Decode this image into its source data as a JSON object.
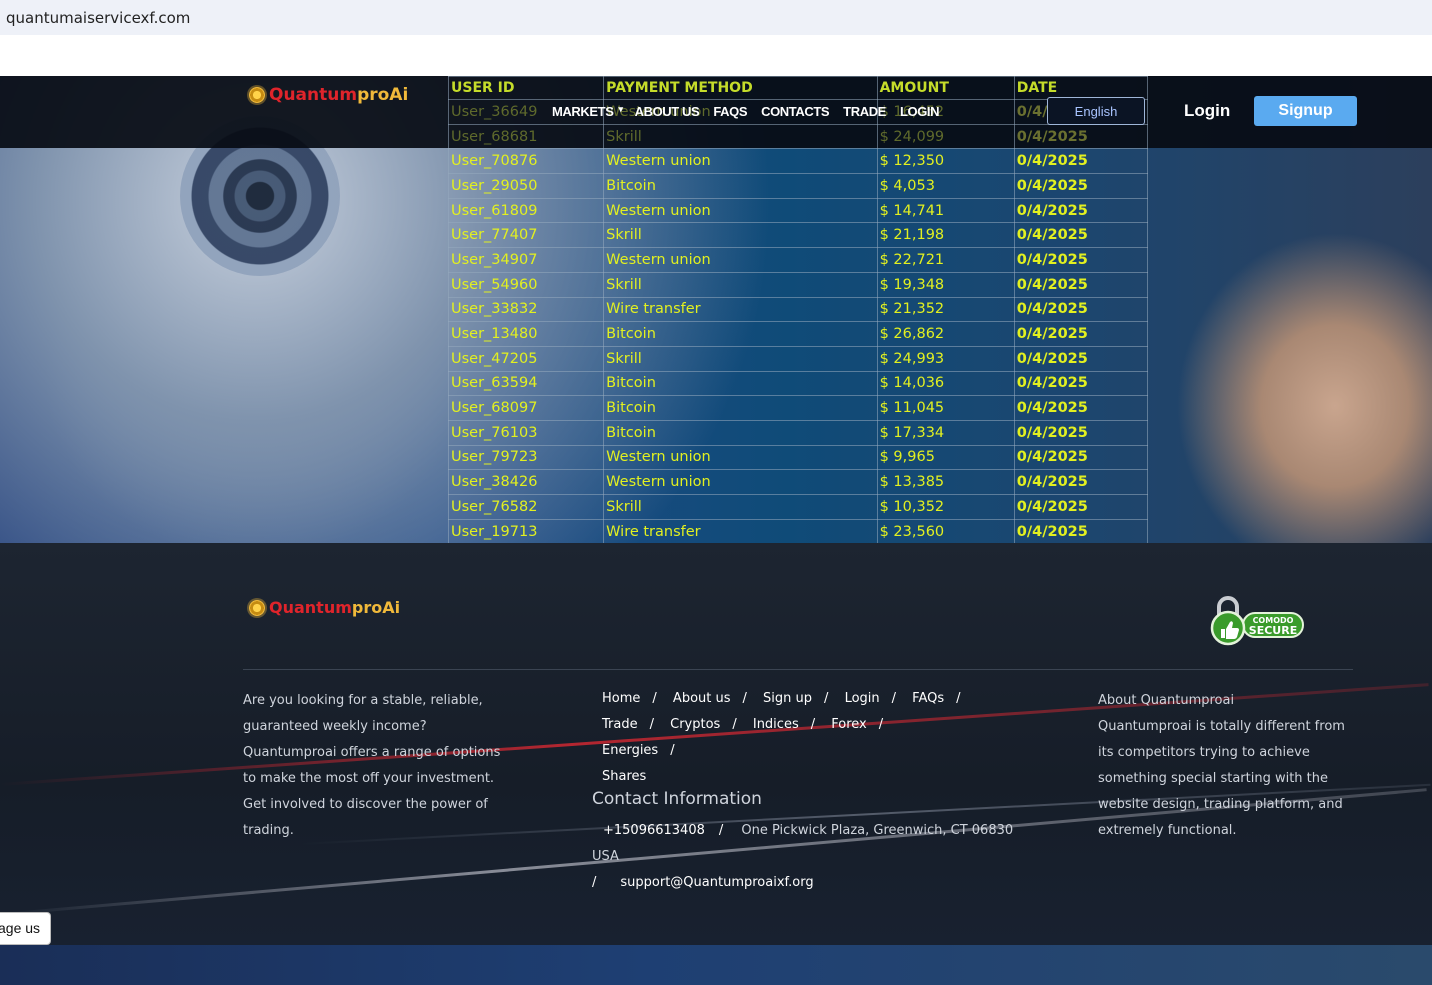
{
  "browser": {
    "url": "quantumaiservicexf.com"
  },
  "brand": {
    "part1": "Quantum",
    "part2": "proAi"
  },
  "nav": {
    "items": [
      "MARKETS",
      "ABOUT US",
      "FAQS",
      "CONTACTS",
      "TRADE",
      "LOGIN"
    ],
    "language": "English",
    "login": "Login",
    "signup": "Signup"
  },
  "transactions": {
    "headers": [
      "USER ID",
      "PAYMENT METHOD",
      "AMOUNT",
      "DATE"
    ],
    "rows": [
      [
        "User_36649",
        "Western union",
        "$ 16,452",
        "0/4/2025"
      ],
      [
        "User_68681",
        "Skrill",
        "$ 24,099",
        "0/4/2025"
      ],
      [
        "User_70876",
        "Western union",
        "$ 12,350",
        "0/4/2025"
      ],
      [
        "User_29050",
        "Bitcoin",
        "$ 4,053",
        "0/4/2025"
      ],
      [
        "User_61809",
        "Western union",
        "$ 14,741",
        "0/4/2025"
      ],
      [
        "User_77407",
        "Skrill",
        "$ 21,198",
        "0/4/2025"
      ],
      [
        "User_34907",
        "Western union",
        "$ 22,721",
        "0/4/2025"
      ],
      [
        "User_54960",
        "Skrill",
        "$ 19,348",
        "0/4/2025"
      ],
      [
        "User_33832",
        "Wire transfer",
        "$ 21,352",
        "0/4/2025"
      ],
      [
        "User_13480",
        "Bitcoin",
        "$ 26,862",
        "0/4/2025"
      ],
      [
        "User_47205",
        "Skrill",
        "$ 24,993",
        "0/4/2025"
      ],
      [
        "User_63594",
        "Bitcoin",
        "$ 14,036",
        "0/4/2025"
      ],
      [
        "User_68097",
        "Bitcoin",
        "$ 11,045",
        "0/4/2025"
      ],
      [
        "User_76103",
        "Bitcoin",
        "$ 17,334",
        "0/4/2025"
      ],
      [
        "User_79723",
        "Western union",
        "$ 9,965",
        "0/4/2025"
      ],
      [
        "User_38426",
        "Western union",
        "$ 13,385",
        "0/4/2025"
      ],
      [
        "User_76582",
        "Skrill",
        "$ 10,352",
        "0/4/2025"
      ],
      [
        "User_19713",
        "Wire transfer",
        "$ 23,560",
        "0/4/2025"
      ]
    ]
  },
  "footer": {
    "about_text": "Are you looking for a stable, reliable, guaranteed weekly income? Quantumproai offers a range of options to make the most off your investment. Get involved to discover the power of trading.",
    "links_row1": [
      "Home",
      "About us",
      "Sign up",
      "Login",
      "FAQs"
    ],
    "links_row2": [
      "Trade",
      "Cryptos",
      "Indices",
      "Forex",
      "Energies"
    ],
    "links_row3": [
      "Shares"
    ],
    "contact_title": "Contact Information",
    "phone": "+15096613408",
    "address": "One Pickwick Plaza, Greenwich, CT 06830 USA",
    "email": "support@Quantumproaixf.org",
    "right_title": "About Quantumproai",
    "right_text": "Quantumproai is totally different from its competitors trying to achieve something special starting with the website design, trading platform, and extremely functional.",
    "badge_line1": "COMODO",
    "badge_line2": "SECURE"
  },
  "message_tab": "age us",
  "colors": {
    "table_text": "#e2f020",
    "signup_bg": "#5aaaf0",
    "brand_red": "#e0242b",
    "brand_gold": "#f0b93a"
  }
}
